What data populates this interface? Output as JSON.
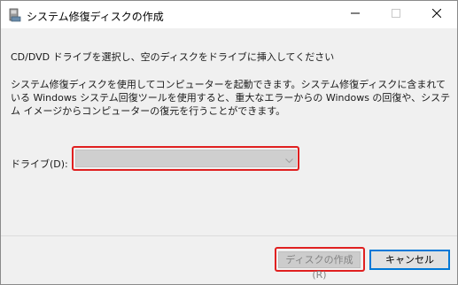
{
  "window": {
    "title": "システム修復ディスクの作成",
    "icon": "disc-drive-icon"
  },
  "controls": {
    "minimize_icon": "minimize-icon",
    "maximize_icon": "maximize-icon",
    "close_icon": "close-icon"
  },
  "content": {
    "instruction": "CD/DVD ドライブを選択し、空のディスクをドライブに挿入してください",
    "description": "システム修復ディスクを使用してコンピューターを起動できます。システム修復ディスクに含まれている Windows システム回復ツールを使用すると、重大なエラーからの Windows の回復や、システム イメージからコンピューターの復元を行うことができます。",
    "drive_label": "ドライブ(D):",
    "drive_value": ""
  },
  "buttons": {
    "create_label": "ディスクの作成(R)",
    "cancel_label": "キャンセル"
  },
  "colors": {
    "highlight": "#e02020",
    "focus": "#0078d7",
    "disabled_bg": "#cccccc",
    "dialog_bg": "#f0f0f0"
  }
}
